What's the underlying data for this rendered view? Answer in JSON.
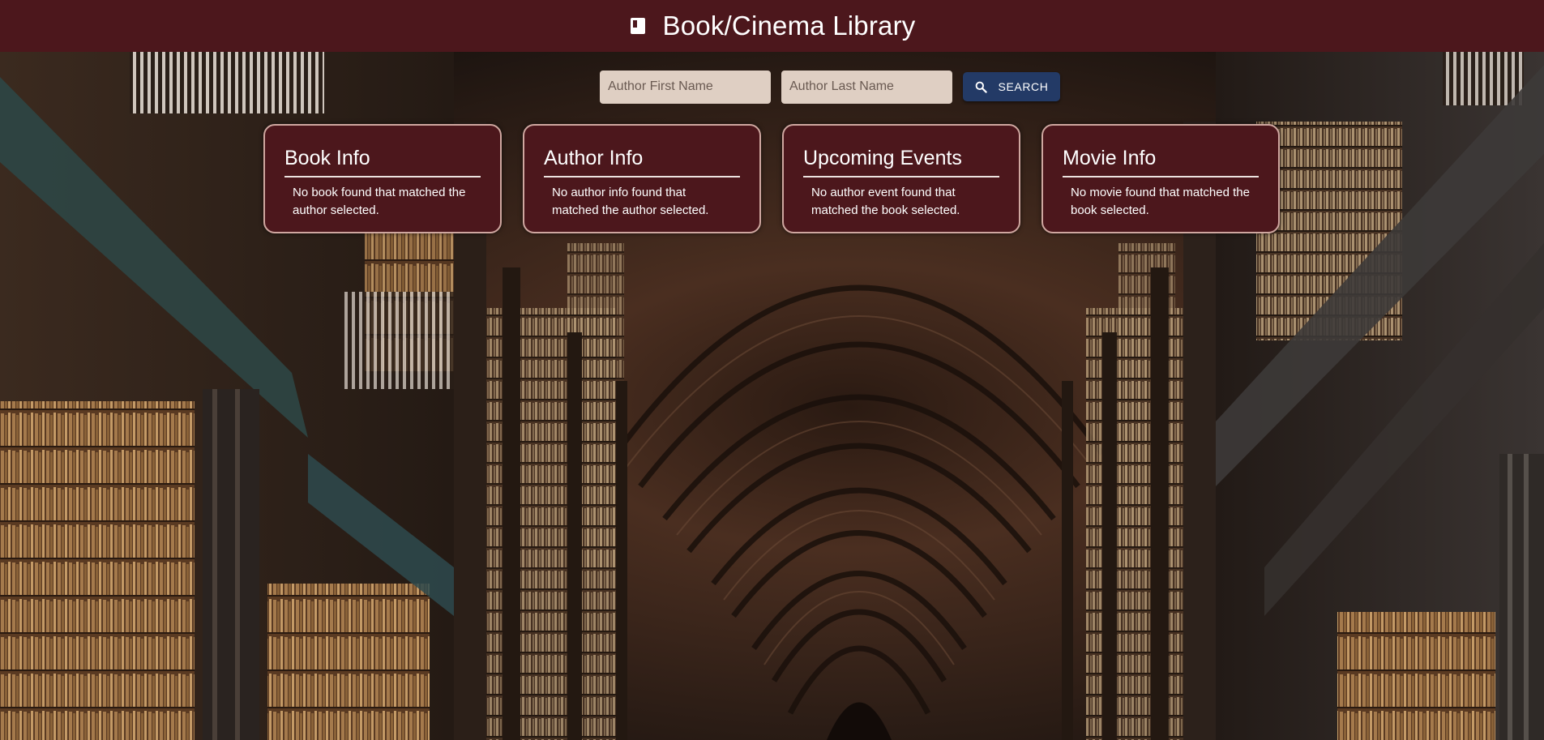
{
  "header": {
    "icon": "book-icon",
    "title": "Book/Cinema Library"
  },
  "search": {
    "first_name_placeholder": "Author First Name",
    "first_name_value": "",
    "last_name_placeholder": "Author Last Name",
    "last_name_value": "",
    "button_label": "SEARCH",
    "button_icon": "search-icon"
  },
  "cards": [
    {
      "title": "Book Info",
      "text": "No book found that matched the author selected."
    },
    {
      "title": "Author Info",
      "text": "No author info found that matched the author selected."
    },
    {
      "title": "Upcoming Events",
      "text": "No author event found that matched the book selected."
    },
    {
      "title": "Movie Info",
      "text": "No movie found that matched the book selected."
    }
  ],
  "colors": {
    "header_bg": "#4c171c",
    "card_bg": "#4c171c",
    "card_border": "#cfa7a0",
    "input_bg": "#dfcfc3",
    "button_bg": "#233a66"
  }
}
